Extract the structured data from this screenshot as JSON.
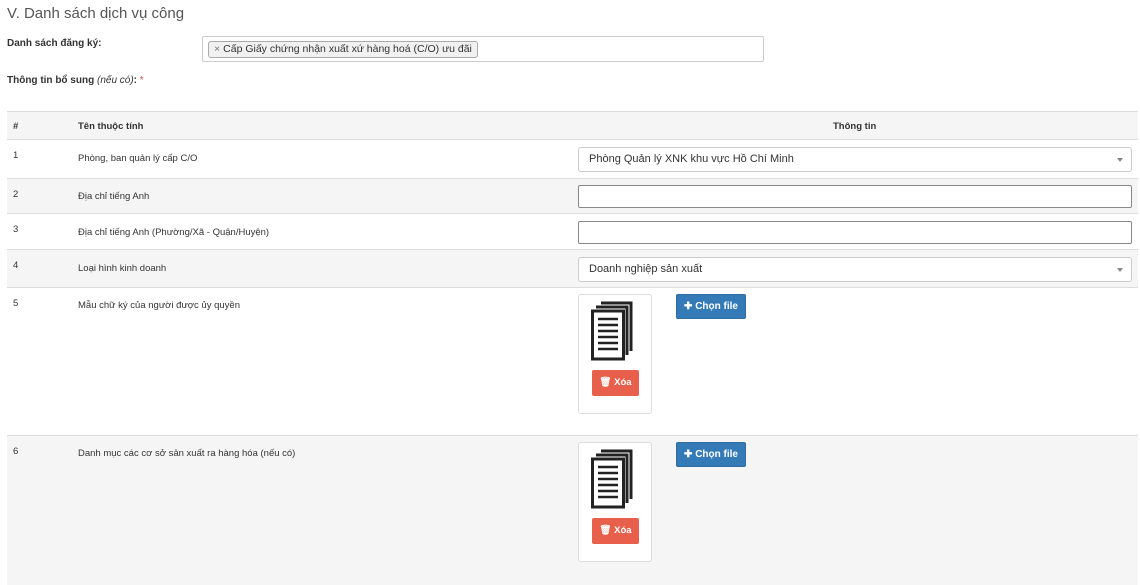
{
  "section_title": "V. Danh sách dịch vụ công",
  "registration": {
    "label": "Danh sách đăng ký:",
    "tag_remove": "×",
    "tag_text": "Cấp Giấy chứng nhận xuất xứ hàng hoá (C/O) ưu đãi"
  },
  "extra_info": {
    "label": "Thông tin bổ sung",
    "optional": "(nếu có)",
    "colon": ":",
    "required_mark": "*"
  },
  "table": {
    "headers": {
      "num": "#",
      "name": "Tên thuộc tính",
      "info": "Thông tin"
    },
    "rows": [
      {
        "num": "1",
        "name": "Phòng, ban quản lý cấp C/O",
        "value": "Phòng Quản lý XNK khu vực Hồ Chí Minh"
      },
      {
        "num": "2",
        "name": "Địa chỉ tiếng Anh",
        "value": ""
      },
      {
        "num": "3",
        "name": "Địa chỉ tiếng Anh (Phường/Xã - Quận/Huyện)",
        "value": ""
      },
      {
        "num": "4",
        "name": "Loại hình kinh doanh",
        "value": "Doanh nghiệp sản xuất"
      },
      {
        "num": "5",
        "name": "Mẫu chữ ký của người được ủy quyền",
        "value": ""
      },
      {
        "num": "6",
        "name": "Danh mục các cơ sở sản xuất ra hàng hóa (nếu có)",
        "value": ""
      }
    ],
    "delete_label": "Xóa",
    "choose_file_label": "Chọn file"
  },
  "icons": {
    "document": "document-icon",
    "trash": "trash-icon",
    "plus": "plus-icon"
  },
  "colors": {
    "primary_button": "#337ab7",
    "danger_button": "#e8604c",
    "required": "#d9534f"
  }
}
